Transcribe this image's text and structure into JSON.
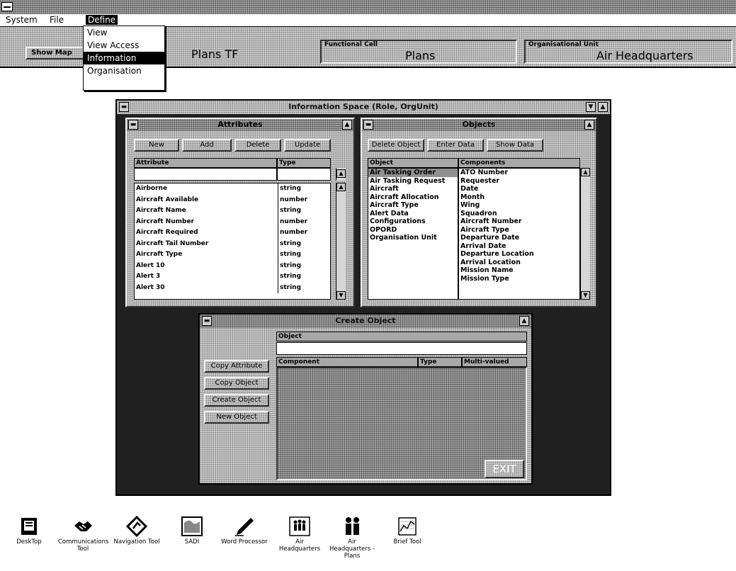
{
  "app": {
    "title": ""
  },
  "menubar": {
    "items": [
      "System",
      "File",
      "Define"
    ]
  },
  "define_menu": {
    "items": [
      "View",
      "View Access",
      "Information",
      "Organisation"
    ]
  },
  "toolbar": {
    "show_map_label": "Show Map",
    "role_value": "Plans TF",
    "functional_cell_label": "Functional Cell",
    "functional_cell_value": "Plans",
    "org_unit_label": "Organisational Unit",
    "org_unit_value": "Air Headquarters"
  },
  "info_space": {
    "title": "Information Space (Role, OrgUnit)",
    "attributes": {
      "title": "Attributes",
      "buttons": [
        "New",
        "Add",
        "Delete",
        "Update"
      ],
      "columns": [
        "Attribute",
        "Type"
      ],
      "edit_attribute_value": "",
      "edit_type_value": "",
      "rows": [
        {
          "name": "Airborne",
          "type": "string"
        },
        {
          "name": "Aircraft Available",
          "type": "number"
        },
        {
          "name": "Aircraft Name",
          "type": "string"
        },
        {
          "name": "Aircraft Number",
          "type": "number"
        },
        {
          "name": "Aircraft Required",
          "type": "number"
        },
        {
          "name": "Aircraft Tail Number",
          "type": "string"
        },
        {
          "name": "Aircraft Type",
          "type": "string"
        },
        {
          "name": "Alert 10",
          "type": "string"
        },
        {
          "name": "Alert 3",
          "type": "string"
        },
        {
          "name": "Alert 30",
          "type": "string"
        }
      ]
    },
    "objects": {
      "title": "Objects",
      "buttons": [
        "Delete Object",
        "Enter Data",
        "Show Data"
      ],
      "columns": [
        "Object",
        "Components"
      ],
      "object_rows": [
        "Air Tasking Order",
        "Air Tasking Request",
        "Aircraft",
        "Aircraft Allocation",
        "Aircraft Type",
        "Alert Data",
        "Configurations",
        "OPORD",
        "Organisation Unit"
      ],
      "selected_object": "Air Tasking Order",
      "component_rows": [
        "ATO Number",
        "Requester",
        "Date",
        "Month",
        "Wing",
        "Squadron",
        "Aircraft Number",
        "Aircraft Type",
        "Departure Date",
        "Arrival Date",
        "Departure Location",
        "Arrival Location",
        "Mission Name",
        "Mission Type"
      ]
    }
  },
  "create_object": {
    "title": "Create Object",
    "object_label": "Object",
    "object_value": "",
    "columns": [
      "Component",
      "Type",
      "Multi-valued"
    ],
    "buttons": [
      "Copy Attribute",
      "Copy Object",
      "Create Object",
      "New Object"
    ],
    "exit_label": "EXIT"
  },
  "desktop_icons": [
    {
      "label": "DeskTop",
      "icon": "desktop-icon"
    },
    {
      "label": "Communications Tool",
      "icon": "handshake-icon"
    },
    {
      "label": "Navigation Tool",
      "icon": "navigation-icon"
    },
    {
      "label": "SADI",
      "icon": "map-icon"
    },
    {
      "label": "Word Processor",
      "icon": "pen-icon"
    },
    {
      "label": "Air Headquarters",
      "icon": "people-group-icon"
    },
    {
      "label": "Air Headquarters - Plans",
      "icon": "people-pair-icon"
    },
    {
      "label": "Brief Tool",
      "icon": "chart-icon"
    }
  ]
}
